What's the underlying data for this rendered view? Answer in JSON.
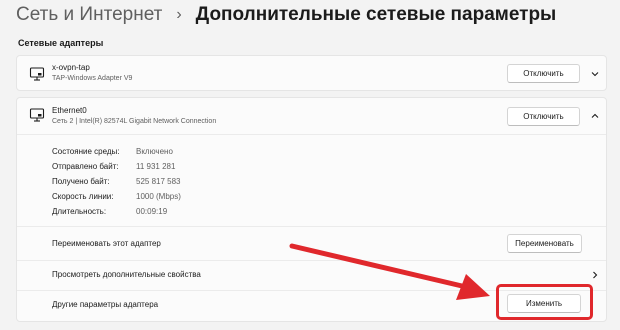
{
  "breadcrumb": {
    "parent": "Сеть и Интернет",
    "separator": "›",
    "current": "Дополнительные сетевые параметры"
  },
  "section": {
    "title": "Сетевые адаптеры"
  },
  "adapters": [
    {
      "icon": "monitor-network-icon",
      "name": "x-ovpn-tap",
      "description": "TAP-Windows Adapter V9",
      "button_label": "Отключить",
      "expanded": false
    },
    {
      "icon": "monitor-network-icon",
      "name": "Ethernet0",
      "description": "Сеть 2 | Intel(R) 82574L Gigabit Network Connection",
      "button_label": "Отключить",
      "expanded": true,
      "properties": [
        {
          "label": "Состояние среды:",
          "value": "Включено"
        },
        {
          "label": "Отправлено байт:",
          "value": "11 931 281"
        },
        {
          "label": "Получено байт:",
          "value": "525 817 583"
        },
        {
          "label": "Скорость линии:",
          "value": "1000 (Mbps)"
        },
        {
          "label": "Длительность:",
          "value": "00:09:19"
        }
      ],
      "rename": {
        "label": "Переименовать этот адаптер",
        "button_label": "Переименовать"
      },
      "more_properties": {
        "label": "Просмотреть дополнительные свойства"
      },
      "other_params": {
        "label": "Другие параметры адаптера",
        "button_label": "Изменить"
      }
    }
  ],
  "annotation": {
    "color": "#e0282c"
  }
}
